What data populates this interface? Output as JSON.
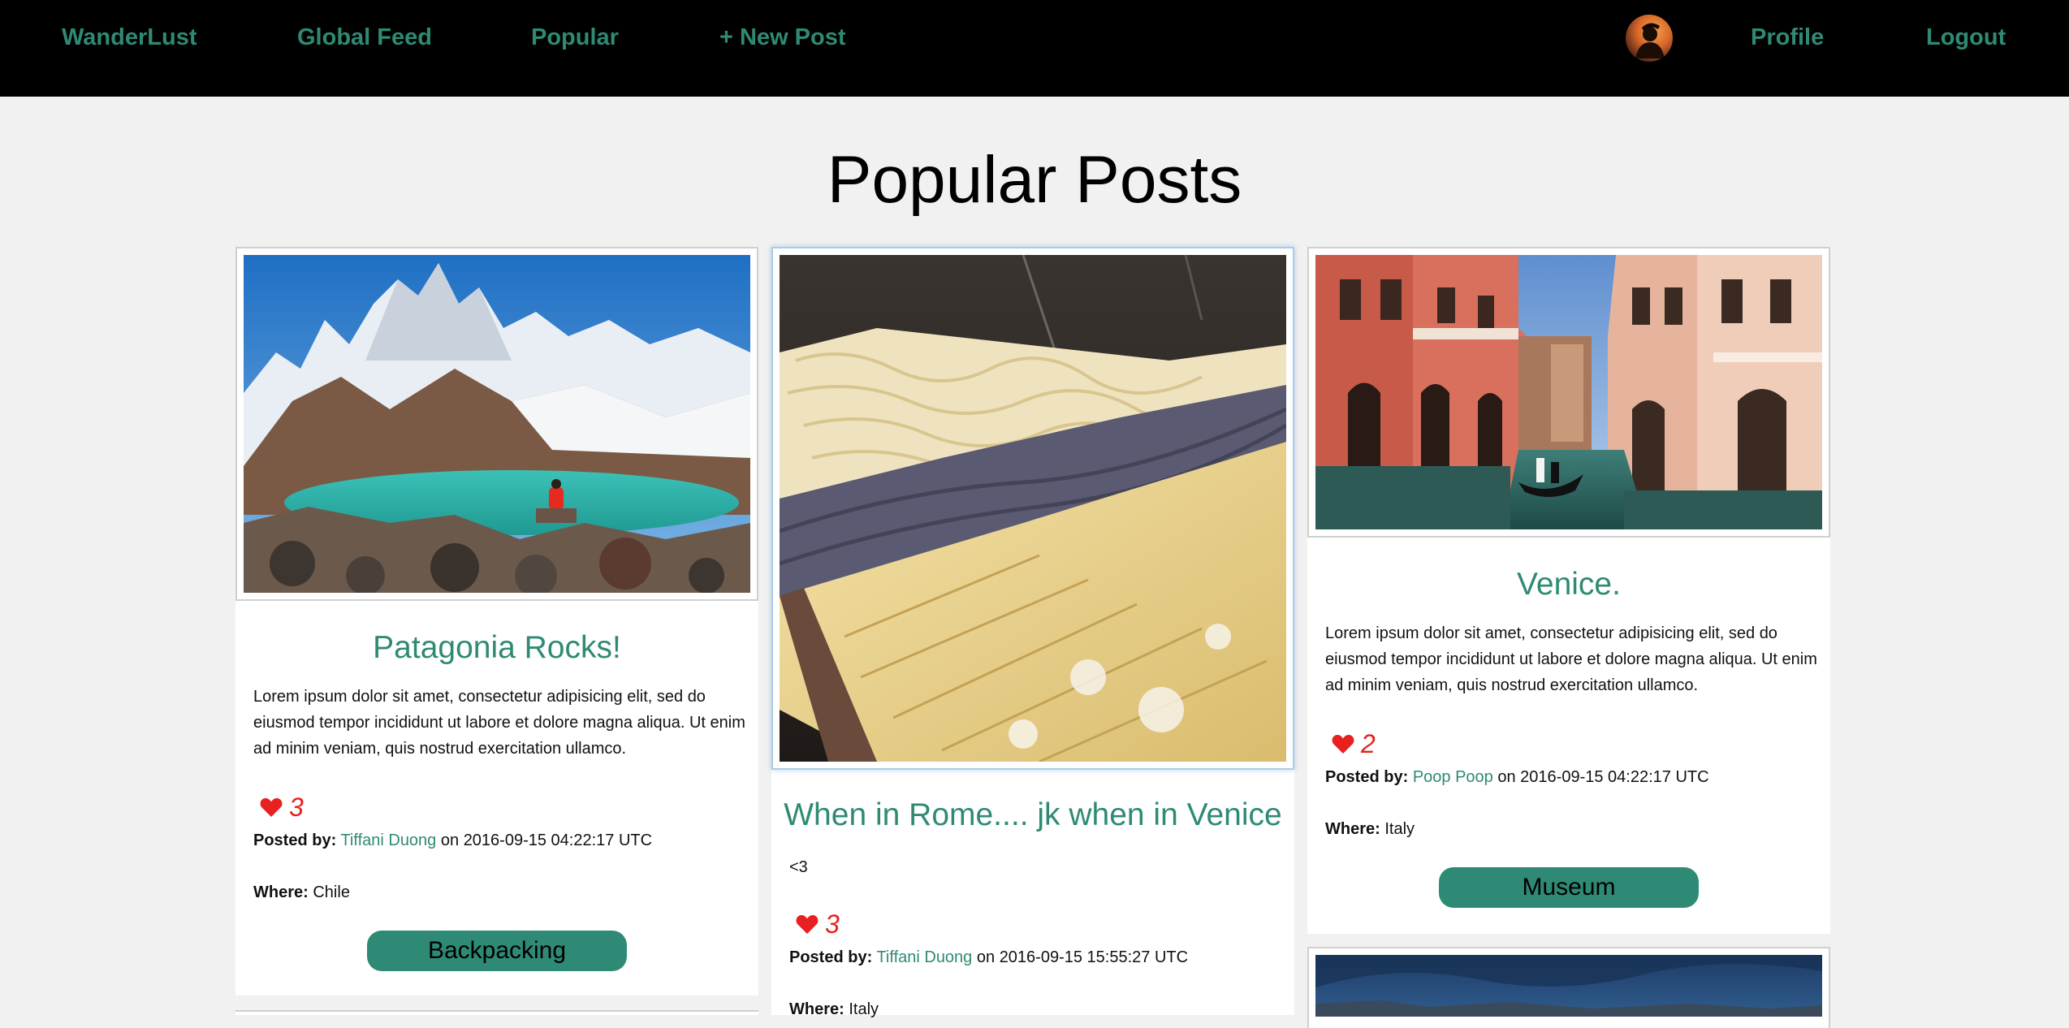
{
  "nav": {
    "brand": "WanderLust",
    "global_feed": "Global Feed",
    "popular": "Popular",
    "new_post": "+ New Post",
    "profile": "Profile",
    "logout": "Logout"
  },
  "page": {
    "title": "Popular Posts"
  },
  "labels": {
    "posted_by": "Posted by:",
    "on": "on",
    "where": "Where:"
  },
  "posts": [
    {
      "title": "Patagonia Rocks!",
      "body": "Lorem ipsum dolor sit amet, consectetur adipisicing elit, sed do eiusmod tempor incididunt ut labore et dolore magna aliqua. Ut enim ad minim veniam, quis nostrud exercitation ullamco.",
      "likes": "3",
      "author": "Tiffani Duong",
      "timestamp": "2016-09-15 04:22:17 UTC",
      "where": "Chile",
      "tag": "Backpacking"
    },
    {
      "title": "When in Rome.... jk when in Venice",
      "body": "<3",
      "likes": "3",
      "author": "Tiffani Duong",
      "timestamp": "2016-09-15 15:55:27 UTC",
      "where": "Italy"
    },
    {
      "title": "Venice.",
      "body": "Lorem ipsum dolor sit amet, consectetur adipisicing elit, sed do eiusmod tempor incididunt ut labore et dolore magna aliqua. Ut enim ad minim veniam, quis nostrud exercitation ullamco.",
      "likes": "2",
      "author": "Poop Poop",
      "timestamp": "2016-09-15 04:22:17 UTC",
      "where": "Italy",
      "tag": "Museum"
    }
  ],
  "colors": {
    "accent": "#2f8a75",
    "like": "#e8201f",
    "nav_bg": "#000000",
    "page_bg": "#f1f1f1"
  },
  "icons": {
    "like": "heart-icon",
    "avatar": "user-avatar"
  }
}
